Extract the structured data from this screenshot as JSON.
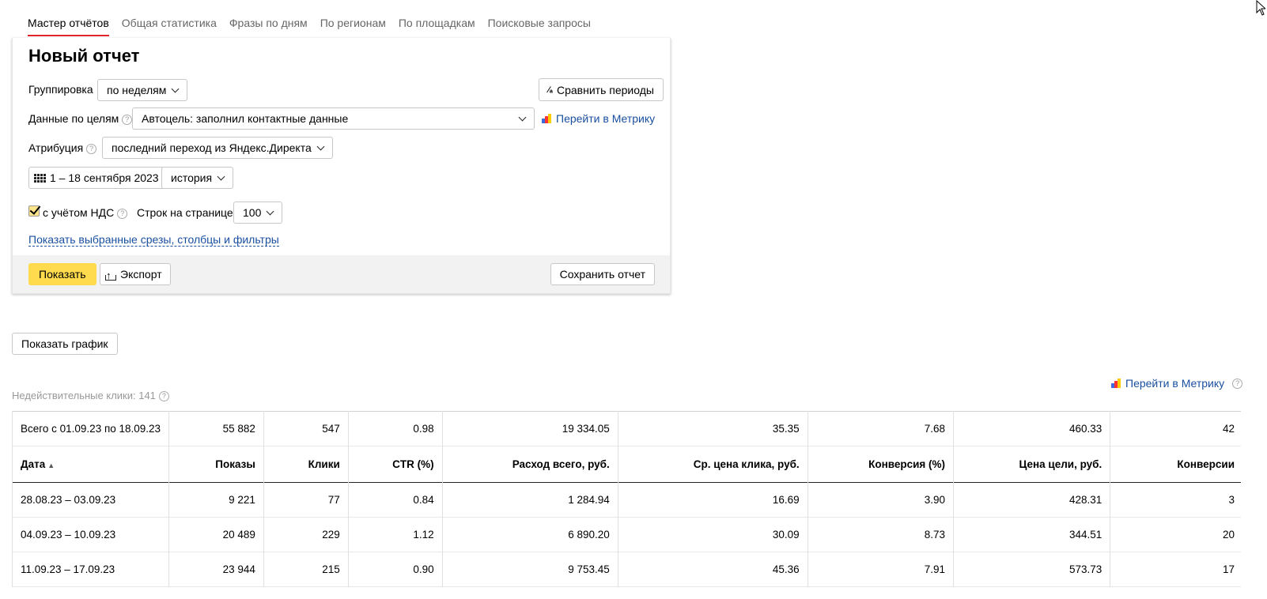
{
  "tabs": [
    {
      "label": "Мастер отчётов",
      "active": true
    },
    {
      "label": "Общая статистика"
    },
    {
      "label": "Фразы по дням"
    },
    {
      "label": "По регионам"
    },
    {
      "label": "По площадкам"
    },
    {
      "label": "Поисковые запросы"
    }
  ],
  "report": {
    "title": "Новый отчет",
    "grouping_label": "Группировка",
    "grouping_value": "по неделям",
    "compare_button": "Сравнить периоды",
    "goals_label": "Данные по целям",
    "goals_value": "Автоцель: заполнил контактные данные",
    "metrika_link": "Перейти в Метрику",
    "attribution_label": "Атрибуция",
    "attribution_value": "последний переход из Яндекс.Директа",
    "date_range": "1 – 18 сентября 2023",
    "history_value": "история",
    "vat_label": "с учётом НДС",
    "vat_checked": true,
    "rows_label": "Строк на странице",
    "rows_value": "100",
    "show_filters_link": "Показать выбранные срезы, столбцы и фильтры",
    "show_button": "Показать",
    "export_button": "Экспорт",
    "save_button": "Сохранить отчет"
  },
  "show_chart_button": "Показать график",
  "invalid_clicks": "Недействительные клики: 141",
  "metrika_link2": "Перейти в Метрику",
  "table": {
    "totals": [
      "Всего с 01.09.23 по 18.09.23",
      "55 882",
      "547",
      "0.98",
      "19 334.05",
      "35.35",
      "7.68",
      "460.33",
      "42"
    ],
    "headers": [
      "Дата",
      "Показы",
      "Клики",
      "CTR (%)",
      "Расход всего, руб.",
      "Ср. цена клика, руб.",
      "Конверсия (%)",
      "Цена цели, руб.",
      "Конверсии"
    ],
    "sort_arrow": "▲",
    "rows": [
      [
        "28.08.23 – 03.09.23",
        "9 221",
        "77",
        "0.84",
        "1 284.94",
        "16.69",
        "3.90",
        "428.31",
        "3"
      ],
      [
        "04.09.23 – 10.09.23",
        "20 489",
        "229",
        "1.12",
        "6 890.20",
        "30.09",
        "8.73",
        "344.51",
        "20"
      ],
      [
        "11.09.23 – 17.09.23",
        "23 944",
        "215",
        "0.90",
        "9 753.45",
        "45.36",
        "7.91",
        "573.73",
        "17"
      ]
    ]
  }
}
